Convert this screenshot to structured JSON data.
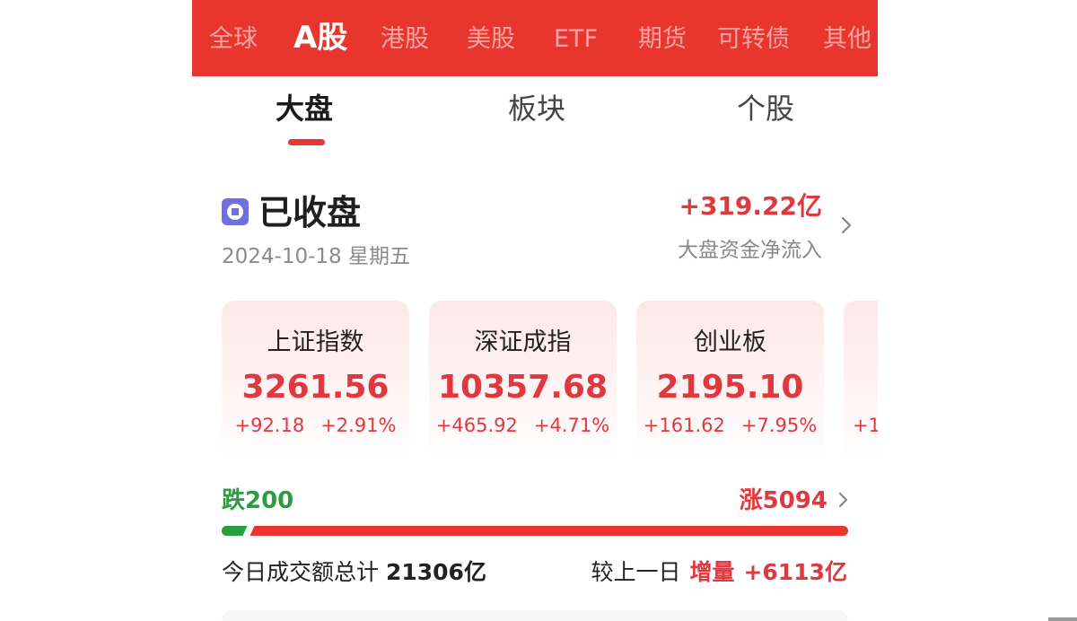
{
  "market_tabs": [
    "全球",
    "A股",
    "港股",
    "美股",
    "ETF",
    "期货",
    "可转债",
    "其他"
  ],
  "active_market_tab": "A股",
  "sub_tabs": [
    "大盘",
    "板块",
    "个股"
  ],
  "active_sub_tab": "大盘",
  "status": {
    "title": "已收盘",
    "date": "2024-10-18 星期五",
    "icon": "stop-circle-icon"
  },
  "fund_flow": {
    "value": "+319.22亿",
    "label": "大盘资金净流入"
  },
  "indices": [
    {
      "name": "上证指数",
      "price": "3261.56",
      "change": "+92.18",
      "pct": "+2.91%"
    },
    {
      "name": "深证成指",
      "price": "10357.68",
      "change": "+465.92",
      "pct": "+4.71%"
    },
    {
      "name": "创业板",
      "price": "2195.10",
      "change": "+161.62",
      "pct": "+7.95%"
    },
    {
      "name": "",
      "price": "",
      "change": "+1",
      "pct": ""
    }
  ],
  "breadth": {
    "fall_label": "跌200",
    "rise_label": "涨5094",
    "fall_count": 200,
    "rise_count": 5094
  },
  "volume": {
    "label": "今日成交额总计",
    "value": "21306亿",
    "compare_label": "较上一日",
    "compare_type": "增量",
    "compare_value": "+6113亿"
  },
  "colors": {
    "brand_red": "#e8362f",
    "up_red": "#e0383e",
    "down_green": "#2a9d3f"
  }
}
